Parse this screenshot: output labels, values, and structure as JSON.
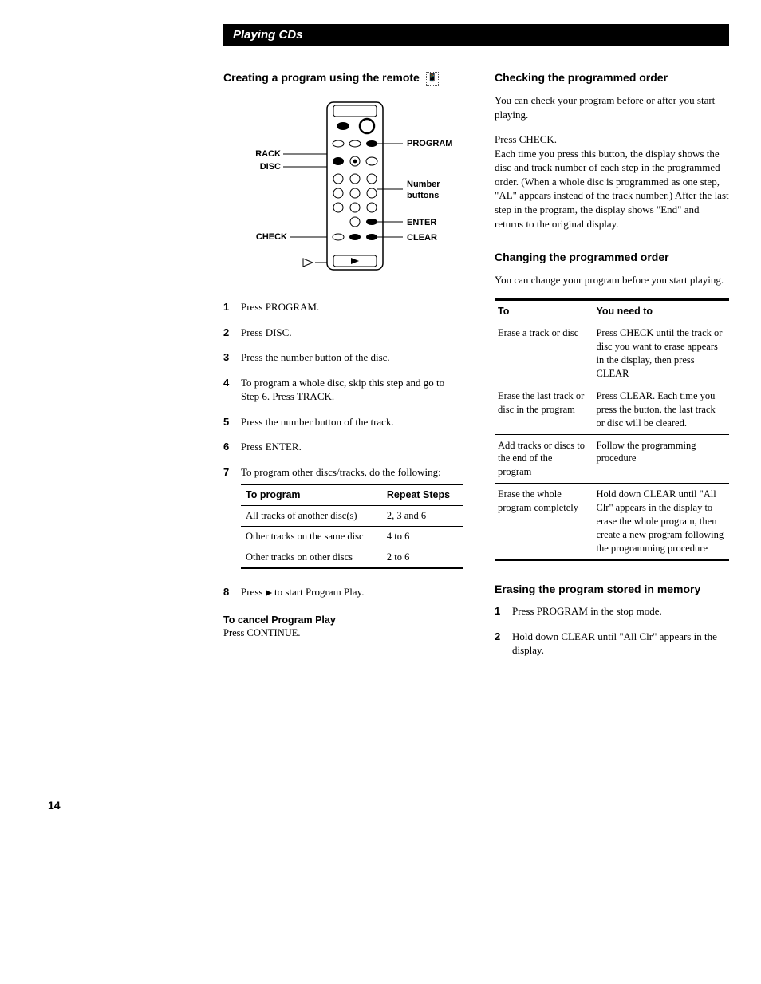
{
  "header": "Playing CDs",
  "left": {
    "title": "Creating a program using the remote",
    "remote_labels": {
      "track": "TRACK",
      "disc": "DISC",
      "check": "CHECK",
      "program": "PROGRAM",
      "number": "Number buttons",
      "enter": "ENTER",
      "clear": "CLEAR"
    },
    "steps": [
      "Press PROGRAM.",
      "Press DISC.",
      "Press the number button of the disc.",
      "To program a whole disc, skip this step and go to Step 6. Press TRACK.",
      "Press the number button of the track.",
      "Press ENTER.",
      "To program other discs/tracks, do the following:",
      "Press ▷ to start Program Play."
    ],
    "subtable": {
      "headers": [
        "To program",
        "Repeat Steps"
      ],
      "rows": [
        [
          "All tracks of another disc(s)",
          "2, 3 and 6"
        ],
        [
          "Other tracks on the same disc",
          "4 to 6"
        ],
        [
          "Other tracks on other discs",
          "2 to 6"
        ]
      ]
    },
    "cancel_title": "To cancel Program Play",
    "cancel_body": "Press CONTINUE."
  },
  "right": {
    "check_title": "Checking the programmed order",
    "check_p1": "You can check your program before or after you start playing.",
    "check_p2a": "Press CHECK.",
    "check_p2b": "Each time you press this button, the display shows the disc and track number of each step in the programmed order. (When a whole disc is programmed as one step, \"AL\" appears instead of the track number.) After the last step in the program, the display shows \"End\" and returns to the original display.",
    "change_title": "Changing the programmed order",
    "change_p1": "You can change your program before you start playing.",
    "change_table": {
      "headers": [
        "To",
        "You need to"
      ],
      "rows": [
        [
          "Erase a track or disc",
          "Press CHECK until the track or disc you want to erase appears in the display, then press CLEAR"
        ],
        [
          "Erase the last track or disc in the program",
          "Press CLEAR. Each time you press the button, the last track or disc will be cleared."
        ],
        [
          "Add tracks or discs to the end of the program",
          "Follow the programming procedure"
        ],
        [
          "Erase the whole program completely",
          "Hold down CLEAR until \"All Clr\" appears in the display to erase the whole program, then create a new program following the programming procedure"
        ]
      ]
    },
    "erase_title": "Erasing the program stored in memory",
    "erase_steps": [
      "Press PROGRAM in the stop mode.",
      "Hold down CLEAR until \"All Clr\" appears in the display."
    ]
  },
  "page_number": "14"
}
